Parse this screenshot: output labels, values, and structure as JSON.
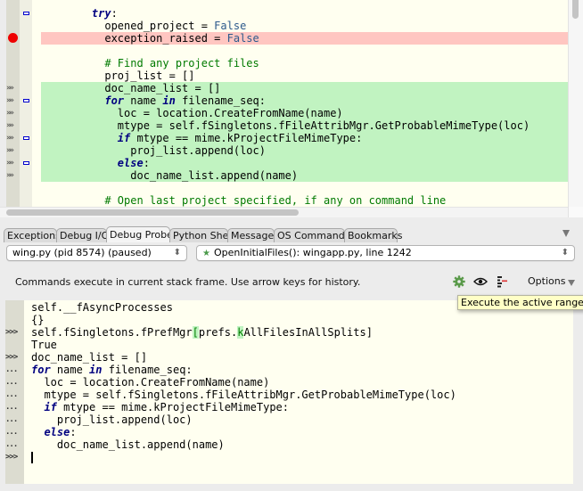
{
  "editor": {
    "lines": [
      {
        "parts": [
          {
            "t": "    "
          },
          {
            "t": "try",
            "c": "kw"
          },
          {
            "t": ":"
          }
        ],
        "fold": true
      },
      {
        "parts": [
          {
            "t": "      opened_project = "
          },
          {
            "t": "False",
            "c": "const"
          }
        ]
      },
      {
        "parts": [
          {
            "t": "      exception_raised = "
          },
          {
            "t": "False",
            "c": "const"
          }
        ],
        "breakpoint": true
      },
      {
        "parts": [
          {
            "t": ""
          }
        ]
      },
      {
        "parts": [
          {
            "t": "      "
          },
          {
            "t": "# Find any project files",
            "c": "cmt"
          }
        ]
      },
      {
        "parts": [
          {
            "t": "      proj_list = []"
          }
        ]
      },
      {
        "parts": [
          {
            "t": "      doc_name_list = []"
          }
        ],
        "active_range": true
      },
      {
        "parts": [
          {
            "t": "      "
          },
          {
            "t": "for",
            "c": "kw"
          },
          {
            "t": " name "
          },
          {
            "t": "in",
            "c": "kw"
          },
          {
            "t": " filename_seq:"
          }
        ],
        "active_range": true,
        "fold": true
      },
      {
        "parts": [
          {
            "t": "        loc = location.CreateFromName(name)"
          }
        ],
        "active_range": true
      },
      {
        "parts": [
          {
            "t": "        mtype = self.fSingletons.fFileAttribMgr.GetProbableMimeType(loc)"
          }
        ],
        "active_range": true
      },
      {
        "parts": [
          {
            "t": "        "
          },
          {
            "t": "if",
            "c": "kw"
          },
          {
            "t": " mtype == mime.kProjectFileMimeType:"
          }
        ],
        "active_range": true,
        "fold": true
      },
      {
        "parts": [
          {
            "t": "          proj_list.append(loc)"
          }
        ],
        "active_range": true
      },
      {
        "parts": [
          {
            "t": "        "
          },
          {
            "t": "else",
            "c": "kw"
          },
          {
            "t": ":"
          }
        ],
        "active_range": true,
        "fold": true
      },
      {
        "parts": [
          {
            "t": "          doc_name_list.append(name)"
          }
        ],
        "active_range": true
      },
      {
        "parts": [
          {
            "t": ""
          }
        ]
      },
      {
        "parts": [
          {
            "t": "      "
          },
          {
            "t": "# Open last project specified, if any on command line",
            "c": "cmt"
          }
        ]
      }
    ],
    "active_range_marker": "»»"
  },
  "tabs": [
    {
      "label": "Exceptions",
      "active": false
    },
    {
      "label": "Debug I/O",
      "active": false
    },
    {
      "label": "Debug Probe",
      "active": true
    },
    {
      "label": "Python Shell",
      "active": false
    },
    {
      "label": "Messages",
      "active": false
    },
    {
      "label": "OS Commands",
      "active": false
    },
    {
      "label": "Bookmarks",
      "active": false
    }
  ],
  "process_select": {
    "value": "wing.py (pid 8574) (paused)"
  },
  "frame_select": {
    "value": "OpenInitialFiles(): wingapp.py, line 1242",
    "icon": "star-icon"
  },
  "info_text": "Commands execute in current stack frame.  Use arrow keys for history.",
  "toolbar": {
    "options_label": "Options",
    "icons": [
      "gear-icon",
      "eye-icon",
      "execute-range-icon"
    ]
  },
  "tooltip": "Execute the active range",
  "probe": {
    "lines": [
      {
        "prompt": "",
        "text": "self.__fAsyncProcesses"
      },
      {
        "prompt": "",
        "text": "{}"
      },
      {
        "prompt": ">>>",
        "parts": [
          {
            "t": "self.fSingletons.fPrefMgr"
          },
          {
            "t": "[",
            "c": "brace-hl"
          },
          {
            "t": "prefs."
          },
          {
            "t": "k",
            "c": "brace-hl"
          },
          {
            "t": "AllFilesInAllSplits]"
          }
        ]
      },
      {
        "prompt": "",
        "text": "True"
      },
      {
        "prompt": ">>>",
        "text": "doc_name_list = []"
      },
      {
        "prompt": "...",
        "parts": [
          {
            "t": "for",
            "c": "kw"
          },
          {
            "t": " name "
          },
          {
            "t": "in",
            "c": "kw"
          },
          {
            "t": " filename_seq:"
          }
        ]
      },
      {
        "prompt": "...",
        "text": "  loc = location.CreateFromName(name)"
      },
      {
        "prompt": "...",
        "text": "  mtype = self.fSingletons.fFileAttribMgr.GetProbableMimeType(loc)"
      },
      {
        "prompt": "...",
        "parts": [
          {
            "t": "  "
          },
          {
            "t": "if",
            "c": "kw"
          },
          {
            "t": " mtype == mime.kProjectFileMimeType:"
          }
        ]
      },
      {
        "prompt": "...",
        "text": "    proj_list.append(loc)"
      },
      {
        "prompt": "...",
        "parts": [
          {
            "t": "  "
          },
          {
            "t": "else",
            "c": "kw"
          },
          {
            "t": ":"
          }
        ]
      },
      {
        "prompt": "...",
        "text": "    doc_name_list.append(name)"
      },
      {
        "prompt": ">>>",
        "text": "",
        "cursor": true
      }
    ]
  },
  "colors": {
    "breakpoint_line": "#ffc6c1",
    "active_range": "#c1f3c1",
    "editor_bg": "#fffff0",
    "keyword": "#000080",
    "comment": "#007a00",
    "breakpoint_dot": "#ee0000",
    "gear_green": "#4a9a4a"
  }
}
